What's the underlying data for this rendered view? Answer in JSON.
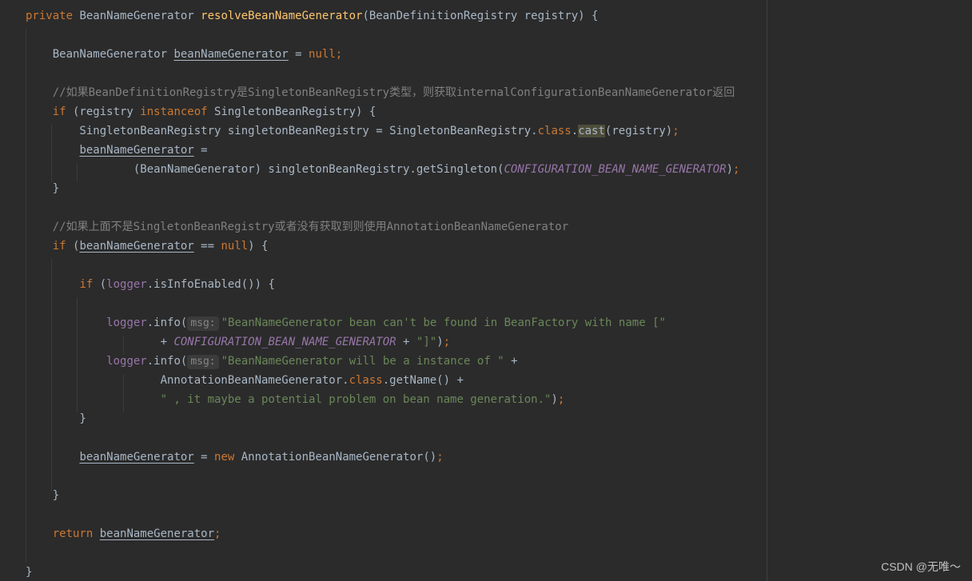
{
  "editor": {
    "lines": [
      {
        "spans": [
          {
            "t": "private ",
            "c": "kw"
          },
          {
            "t": "BeanNameGenerator "
          },
          {
            "t": "resolveBeanNameGenerator",
            "c": "fn"
          },
          {
            "t": "(BeanDefinitionRegistry registry) {"
          }
        ]
      },
      {
        "spans": []
      },
      {
        "spans": [
          {
            "t": "    BeanNameGenerator "
          },
          {
            "t": "beanNameGenerator",
            "c": "ul"
          },
          {
            "t": " = "
          },
          {
            "t": "null",
            "c": "kw"
          },
          {
            "t": ";",
            "c": "kw"
          }
        ]
      },
      {
        "spans": []
      },
      {
        "spans": [
          {
            "t": "    //如果BeanDefinitionRegistry是SingletonBeanRegistry类型，则获取internalConfigurationBeanNameGenerator返回",
            "c": "cmt"
          }
        ]
      },
      {
        "spans": [
          {
            "t": "    "
          },
          {
            "t": "if",
            "c": "kw"
          },
          {
            "t": " (registry "
          },
          {
            "t": "instanceof",
            "c": "kw"
          },
          {
            "t": " SingletonBeanRegistry) {"
          }
        ]
      },
      {
        "spans": [
          {
            "t": "        SingletonBeanRegistry singletonBeanRegistry = SingletonBeanRegistry."
          },
          {
            "t": "class",
            "c": "kw"
          },
          {
            "t": "."
          },
          {
            "t": "cast",
            "c": "hl"
          },
          {
            "t": "(registry)"
          },
          {
            "t": ";",
            "c": "kw"
          }
        ]
      },
      {
        "spans": [
          {
            "t": "        "
          },
          {
            "t": "beanNameGenerator",
            "c": "ul"
          },
          {
            "t": " ="
          }
        ]
      },
      {
        "spans": [
          {
            "t": "                (BeanNameGenerator) singletonBeanRegistry.getSingleton("
          },
          {
            "t": "CONFIGURATION_BEAN_NAME_GENERATOR",
            "c": "const"
          },
          {
            "t": ")"
          },
          {
            "t": ";",
            "c": "kw"
          }
        ]
      },
      {
        "spans": [
          {
            "t": "    }"
          }
        ]
      },
      {
        "spans": []
      },
      {
        "spans": [
          {
            "t": "    //如果上面不是SingletonBeanRegistry或者没有获取到则使用AnnotationBeanNameGenerator",
            "c": "cmt"
          }
        ]
      },
      {
        "spans": [
          {
            "t": "    "
          },
          {
            "t": "if",
            "c": "kw"
          },
          {
            "t": " ("
          },
          {
            "t": "beanNameGenerator",
            "c": "ul"
          },
          {
            "t": " == "
          },
          {
            "t": "null",
            "c": "kw"
          },
          {
            "t": ") {"
          }
        ]
      },
      {
        "spans": []
      },
      {
        "spans": [
          {
            "t": "        "
          },
          {
            "t": "if",
            "c": "kw"
          },
          {
            "t": " ("
          },
          {
            "t": "logger",
            "c": "field"
          },
          {
            "t": ".isInfoEnabled()) {"
          }
        ]
      },
      {
        "spans": []
      },
      {
        "spans": [
          {
            "t": "            "
          },
          {
            "t": "logger",
            "c": "field"
          },
          {
            "t": ".info("
          },
          {
            "t": "msg:",
            "c": "hint"
          },
          {
            "t": "\"BeanNameGenerator bean can't be found in BeanFactory with name [\"",
            "c": "str"
          }
        ]
      },
      {
        "spans": [
          {
            "t": "                    + "
          },
          {
            "t": "CONFIGURATION_BEAN_NAME_GENERATOR",
            "c": "const"
          },
          {
            "t": " + "
          },
          {
            "t": "\"]\"",
            "c": "str"
          },
          {
            "t": ")"
          },
          {
            "t": ";",
            "c": "kw"
          }
        ]
      },
      {
        "spans": [
          {
            "t": "            "
          },
          {
            "t": "logger",
            "c": "field"
          },
          {
            "t": ".info("
          },
          {
            "t": "msg:",
            "c": "hint"
          },
          {
            "t": "\"BeanNameGenerator will be a instance of \"",
            "c": "str"
          },
          {
            "t": " +"
          }
        ]
      },
      {
        "spans": [
          {
            "t": "                    AnnotationBeanNameGenerator."
          },
          {
            "t": "class",
            "c": "kw"
          },
          {
            "t": ".getName() +"
          }
        ]
      },
      {
        "spans": [
          {
            "t": "                    "
          },
          {
            "t": "\" , it maybe a potential problem on bean name generation.\"",
            "c": "str"
          },
          {
            "t": ")"
          },
          {
            "t": ";",
            "c": "kw"
          }
        ]
      },
      {
        "spans": [
          {
            "t": "        }"
          }
        ]
      },
      {
        "spans": []
      },
      {
        "spans": [
          {
            "t": "        "
          },
          {
            "t": "beanNameGenerator",
            "c": "ul"
          },
          {
            "t": " = "
          },
          {
            "t": "new",
            "c": "kw"
          },
          {
            "t": " AnnotationBeanNameGenerator()"
          },
          {
            "t": ";",
            "c": "kw"
          }
        ]
      },
      {
        "spans": []
      },
      {
        "spans": [
          {
            "t": "    }"
          }
        ]
      },
      {
        "spans": []
      },
      {
        "spans": [
          {
            "t": "    "
          },
          {
            "t": "return",
            "c": "kw"
          },
          {
            "t": " "
          },
          {
            "t": "beanNameGenerator",
            "c": "ul"
          },
          {
            "t": ";",
            "c": "kw"
          }
        ]
      },
      {
        "spans": []
      },
      {
        "spans": [
          {
            "t": "}"
          }
        ]
      }
    ]
  },
  "watermark": "CSDN @无唯～",
  "colors": {
    "background": "#2b2b2b",
    "keyword": "#cc7832",
    "method": "#ffc66d",
    "field": "#9876aa",
    "string": "#6a8759",
    "comment": "#808080",
    "text": "#a9b7c6"
  }
}
